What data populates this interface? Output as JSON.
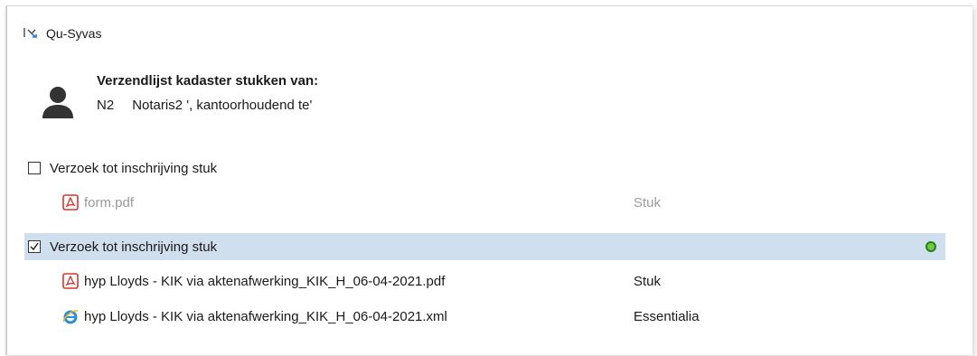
{
  "app": {
    "title": "Qu-Syvas",
    "back_icon": "back-arrow-icon"
  },
  "header": {
    "title": "Verzendlijst kadaster stukken van:",
    "code": "N2",
    "name": "Notaris2 ', kantoorhoudend te'",
    "icon": "person-icon"
  },
  "groups": [
    {
      "label": "Verzoek tot inschrijving stuk",
      "checked": false,
      "selected": false,
      "files": [
        {
          "name": "form.pdf",
          "type": "Stuk",
          "icon": "pdf-icon",
          "dimmed": true
        }
      ]
    },
    {
      "label": "Verzoek tot inschrijving stuk",
      "checked": true,
      "selected": true,
      "status_color": "#6fc83d",
      "files": [
        {
          "name": "hyp Lloyds - KIK via aktenafwerking_KIK_H_06-04-2021.pdf",
          "type": "Stuk",
          "icon": "pdf-icon",
          "dimmed": false
        },
        {
          "name": "hyp Lloyds - KIK via aktenafwerking_KIK_H_06-04-2021.xml",
          "type": "Essentialia",
          "icon": "internet-explorer-icon",
          "dimmed": false
        }
      ]
    }
  ],
  "colors": {
    "selection": "#cfdfee",
    "status_ok": "#6fc83d",
    "pdf_red": "#d9352b"
  }
}
